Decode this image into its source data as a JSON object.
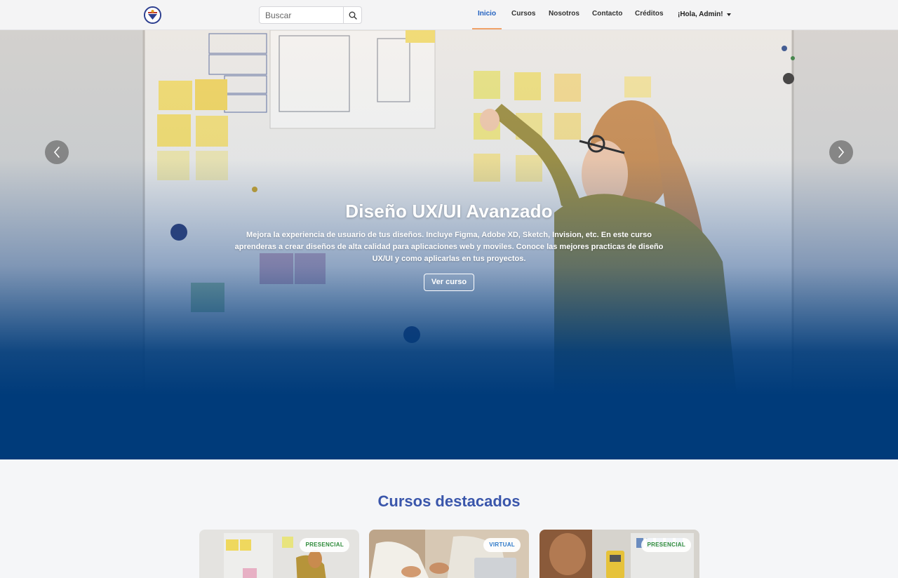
{
  "navbar": {
    "logo_name": "site-logo",
    "search": {
      "placeholder": "Buscar",
      "value": ""
    },
    "items": [
      {
        "label": "Inicio",
        "active": true
      },
      {
        "label": "Cursos",
        "active": false
      },
      {
        "label": "Nosotros",
        "active": false
      },
      {
        "label": "Contacto",
        "active": false
      },
      {
        "label": "Créditos",
        "active": false
      }
    ],
    "user_greeting": "¡Hola, Admin!"
  },
  "hero": {
    "title": "Diseño UX/UI Avanzado",
    "description": "Mejora la experiencia de usuario de tus diseños. Incluye Figma, Adobe XD, Sketch, Invision, etc. En este curso aprenderas a crear diseños de alta calidad para aplicaciones web y moviles. Conoce las mejores practicas de diseño UX/UI y como aplicarlas en tus proyectos.",
    "button_label": "Ver curso",
    "prev_icon": "chevron-left-icon",
    "next_icon": "chevron-right-icon"
  },
  "featured": {
    "title": "Cursos destacados",
    "cards": [
      {
        "badge": "PRESENCIAL",
        "badge_color": "#2e8b3a"
      },
      {
        "badge": "VIRTUAL",
        "badge_color": "#2b78c9"
      },
      {
        "badge": "PRESENCIAL",
        "badge_color": "#2e8b3a"
      }
    ]
  },
  "colors": {
    "accent": "#1f5fbf",
    "hero_blue": "#003b7a",
    "section_title": "#3a56ab",
    "active_underline": "#f0a268"
  }
}
